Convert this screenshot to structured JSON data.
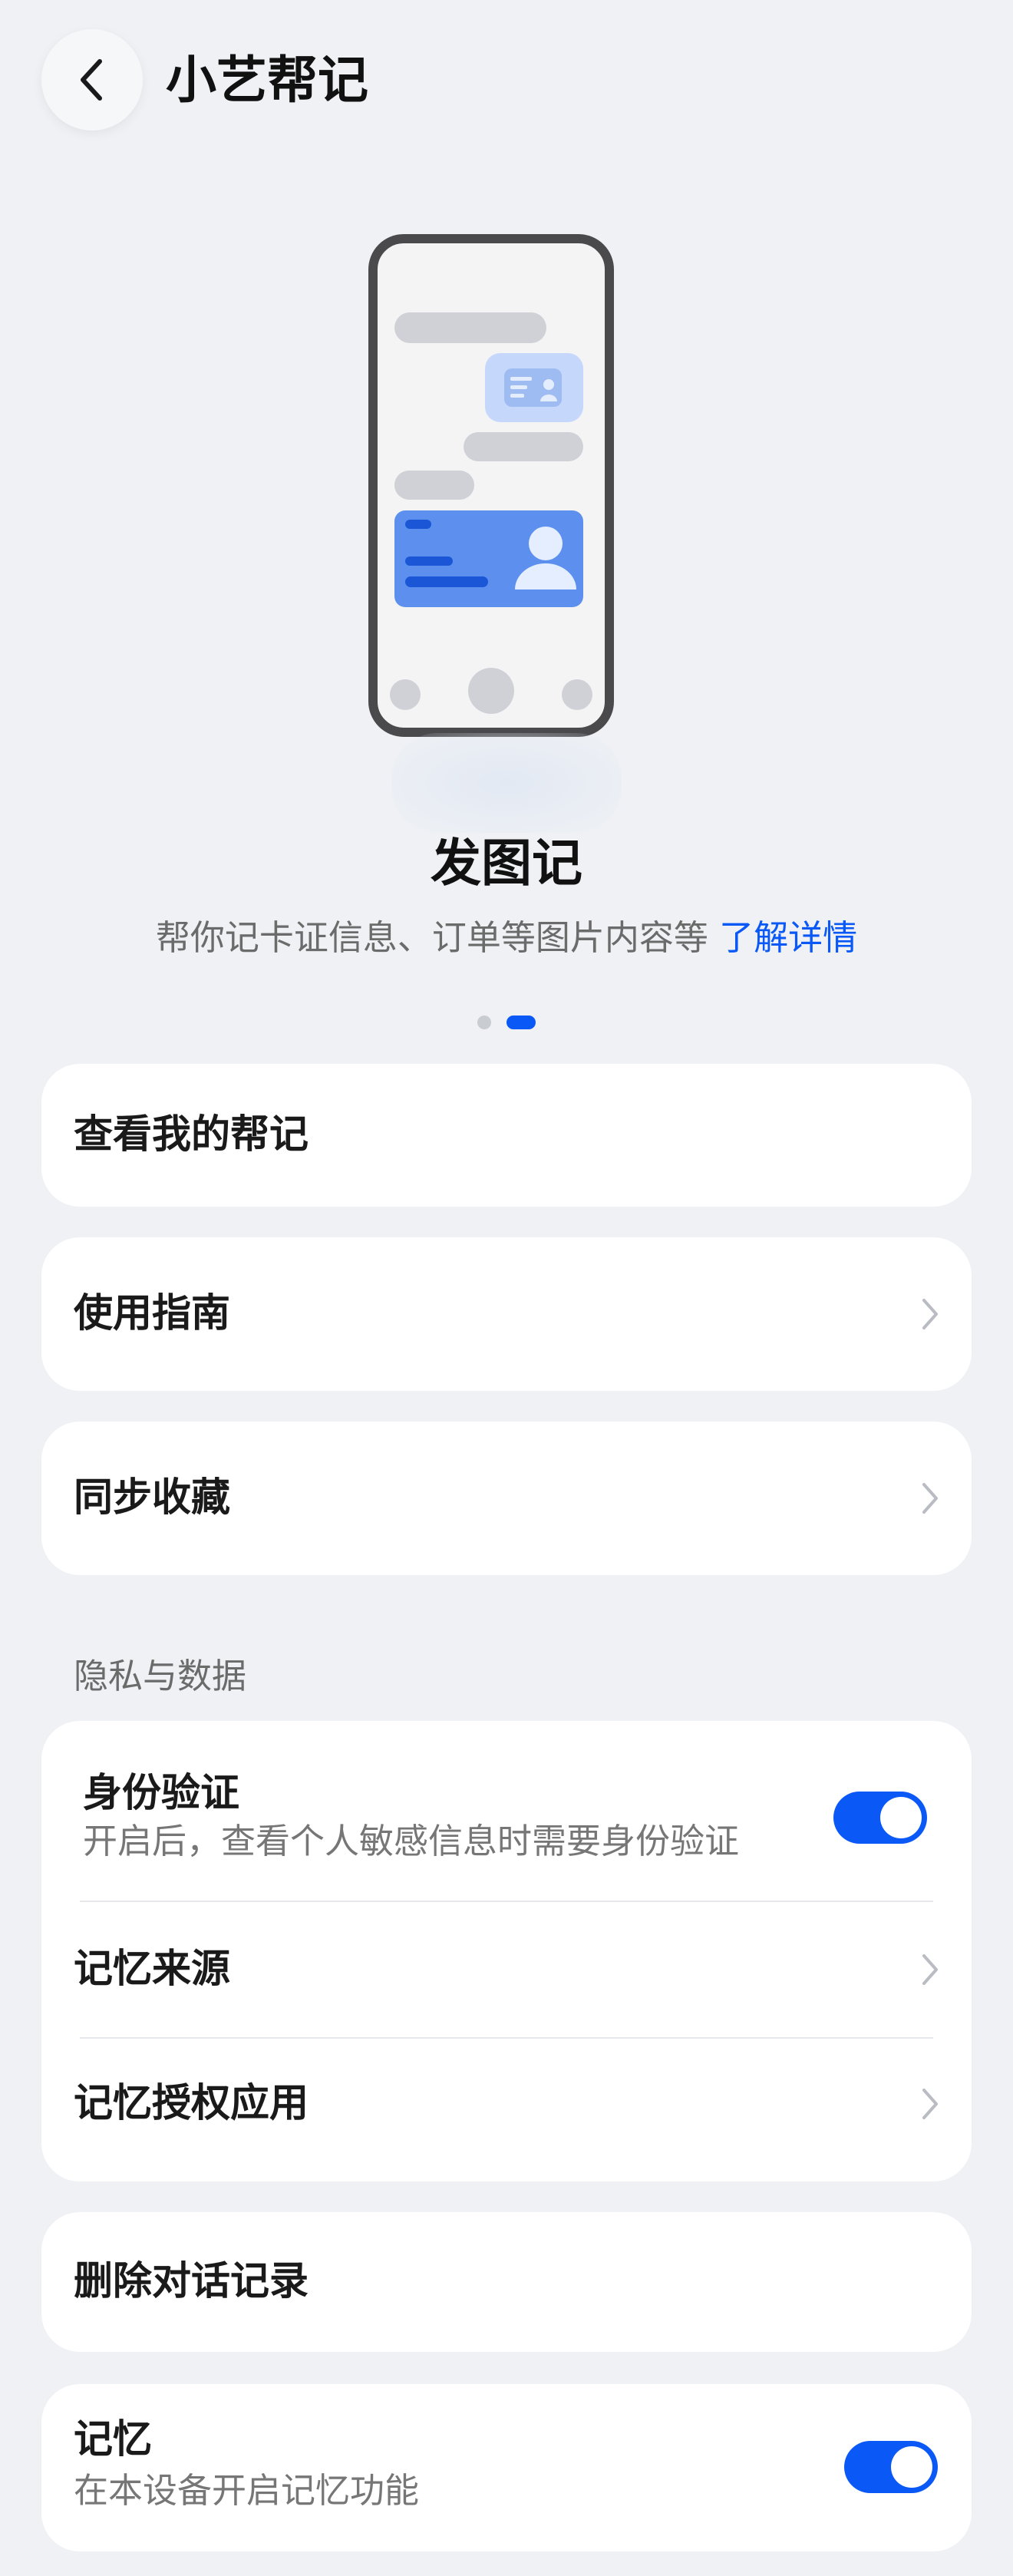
{
  "header": {
    "title": "小艺帮记",
    "back_icon": "chevron-left-icon"
  },
  "feature": {
    "title": "发图记",
    "description": "帮你记卡证信息、订单等图片内容等",
    "link": "了解详情",
    "carousel": {
      "total": 2,
      "active": 2
    }
  },
  "menu": {
    "view_notes": "查看我的帮记",
    "guide": "使用指南",
    "sync_favorites": "同步收藏"
  },
  "privacy": {
    "section_title": "隐私与数据",
    "identity": {
      "label": "身份验证",
      "description": "开启后，查看个人敏感信息时需要身份验证",
      "enabled": true
    },
    "memory_source": "记忆来源",
    "memory_apps": "记忆授权应用"
  },
  "delete_history": "删除对话记录",
  "memory": {
    "label": "记忆",
    "description": "在本设备开启记忆功能",
    "enabled": true
  },
  "colors": {
    "accent": "#0a59f7",
    "background": "#eff1f4",
    "card": "#ffffff"
  }
}
